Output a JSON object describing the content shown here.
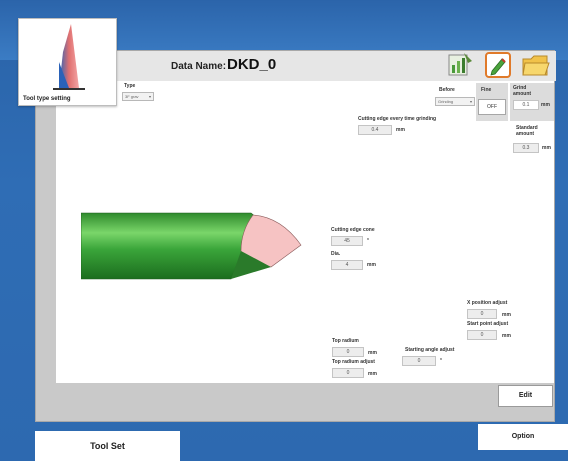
{
  "tool_card": {
    "label": "Tool type setting"
  },
  "header": {
    "data_name_label": "Data Name:",
    "data_name_value": "DKD_0"
  },
  "toolbar": {
    "icons": [
      "chart-icon",
      "edit-icon",
      "folder-icon"
    ]
  },
  "type": {
    "label": "Type",
    "value": "3F grav"
  },
  "cutting_edge_every_time_grinding": {
    "label": "Cutting edge every time grinding",
    "value": "0.4",
    "unit": "mm"
  },
  "before": {
    "label": "Before",
    "value": "Grinding"
  },
  "fine": {
    "label": "Fine",
    "value": "OFF"
  },
  "grind_amount": {
    "label": "Grind amount",
    "value": "0.1",
    "unit": "mm"
  },
  "standard_amount": {
    "label": "Standard amount",
    "value": "0.3",
    "unit": "mm"
  },
  "cutting_edge_cone": {
    "label": "Cutting edge cone",
    "value": "45",
    "unit": "°"
  },
  "dia": {
    "label": "Dia.",
    "value": "4",
    "unit": "mm"
  },
  "x_position_adjust": {
    "label": "X position adjust",
    "value": "0",
    "unit": "mm"
  },
  "start_point_adjust": {
    "label": "Start point adjust",
    "value": "0",
    "unit": "mm"
  },
  "top_radium": {
    "label": "Top radium",
    "value": "0",
    "unit": "mm"
  },
  "top_radium_adjust": {
    "label": "Top radium adjust",
    "value": "0",
    "unit": "mm"
  },
  "starting_angle_adjust": {
    "label": "Starting angle adjust",
    "value": "0",
    "unit": "°"
  },
  "buttons": {
    "edit": "Edit"
  },
  "tabs": {
    "tool_set": "Tool Set",
    "option": "Option"
  }
}
